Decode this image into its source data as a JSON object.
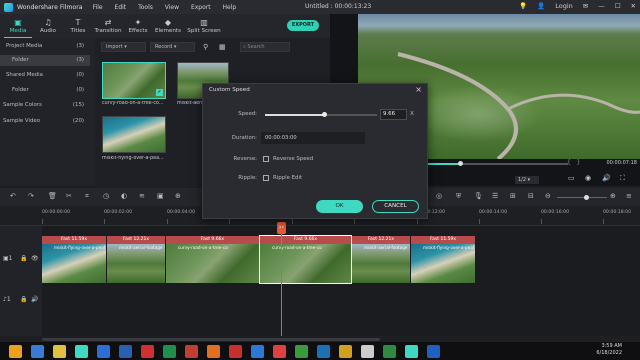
{
  "app": {
    "name": "Wondershare Filmora",
    "menu": [
      "File",
      "Edit",
      "Tools",
      "View",
      "Export",
      "Help"
    ],
    "doc_title": "Untitled : 00:00:13:23",
    "login": "Login"
  },
  "toolbar": {
    "tabs": [
      {
        "label": "Media",
        "icon": "media-icon"
      },
      {
        "label": "Audio",
        "icon": "audio-icon"
      },
      {
        "label": "Titles",
        "icon": "titles-icon"
      },
      {
        "label": "Transition",
        "icon": "transition-icon"
      },
      {
        "label": "Effects",
        "icon": "effects-icon"
      },
      {
        "label": "Elements",
        "icon": "elements-icon"
      },
      {
        "label": "Split Screen",
        "icon": "split-screen-icon"
      }
    ],
    "export_label": "EXPORT"
  },
  "left_panel": {
    "items": [
      {
        "label": "Project Media",
        "count": "(3)"
      },
      {
        "label": "Folder",
        "count": "(3)"
      },
      {
        "label": "Shared Media",
        "count": "(0)"
      },
      {
        "label": "Folder",
        "count": "(0)"
      },
      {
        "label": "Sample Colors",
        "count": "(15)"
      },
      {
        "label": "Sample Video",
        "count": "(20)"
      }
    ]
  },
  "library": {
    "import_label": "Import",
    "record_label": "Record",
    "search_placeholder": "Search",
    "items": [
      {
        "caption": "curvy-road-on-a-tree-co..."
      },
      {
        "caption": "miskit-aeri..."
      },
      {
        "caption": "miskit-flying-over-a-pea..."
      }
    ]
  },
  "preview": {
    "timecode": "00:00:07:18",
    "quality": "1/2",
    "progress": 0.24
  },
  "ruler": {
    "labels": [
      "00:00:00:00",
      "00:00:02:00",
      "00:00:04:00",
      "00:00:12:00",
      "00:00:14:00",
      "00:00:16:00",
      "00:00:18:00"
    ]
  },
  "clips": [
    {
      "speed": "Fast 11.59x",
      "name": "miskit-flying-over-a-peaf"
    },
    {
      "speed": "Fast 12.21x",
      "name": "miskit-aerial-footage"
    },
    {
      "speed": "Fast 9.66x",
      "name": "curvy-road-on-a-tree-co"
    },
    {
      "speed": "Fast 9.66x",
      "name": "curvy-road-on-a-tree-co"
    },
    {
      "speed": "Fast 12.21x",
      "name": "miskit-aerial-footage"
    },
    {
      "speed": "Fast 11.59x",
      "name": "miskit-flying-over-a-peaf"
    }
  ],
  "dialog": {
    "title": "Custom Speed",
    "speed_label": "Speed:",
    "speed_value": "9.66",
    "speed_unit": "X",
    "speed_slider_fraction": 0.53,
    "duration_label": "Duration:",
    "duration_value": "00:00:03:00",
    "reverse_label": "Reverse:",
    "reverse_option": "Reverse Speed",
    "ripple_label": "Ripple:",
    "ripple_option": "Ripple Edit",
    "ok_label": "OK",
    "cancel_label": "CANCEL"
  },
  "taskbar": {
    "time": "3:59 AM",
    "date": "6/18/2022"
  }
}
